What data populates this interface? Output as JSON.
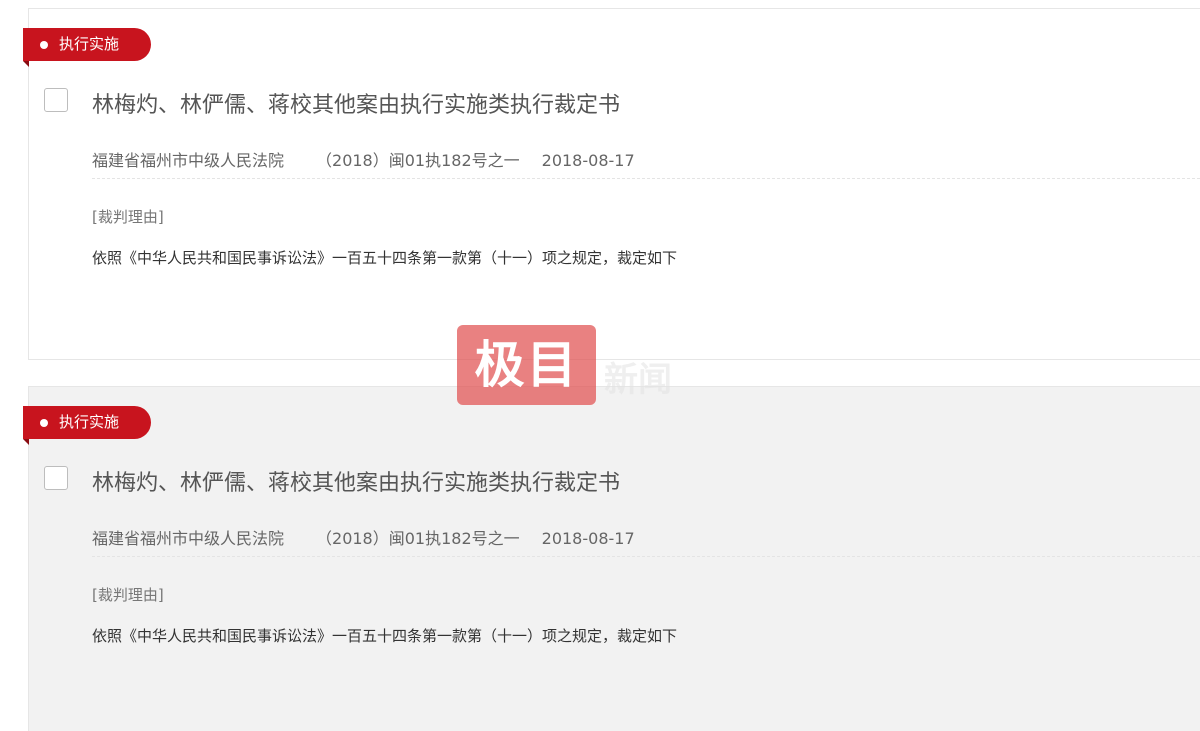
{
  "results": [
    {
      "tag": "执行实施",
      "title": "林梅灼、林俨儒、蒋校其他案由执行实施类执行裁定书",
      "court": "福建省福州市中级人民法院",
      "case_number": "（2018）闽01执182号之一",
      "date": "2018-08-17",
      "reason_label": "[裁判理由]",
      "reason_text": "依照《中华人民共和国民事诉讼法》一百五十四条第一款第（十一）项之规定，裁定如下"
    },
    {
      "tag": "执行实施",
      "title": "林梅灼、林俨儒、蒋校其他案由执行实施类执行裁定书",
      "court": "福建省福州市中级人民法院",
      "case_number": "（2018）闽01执182号之一",
      "date": "2018-08-17",
      "reason_label": "[裁判理由]",
      "reason_text": "依照《中华人民共和国民事诉讼法》一百五十四条第一款第（十一）项之规定，裁定如下"
    }
  ],
  "watermark": {
    "logo_text": "极目",
    "trailing_text": "新闻"
  },
  "colors": {
    "tag_red": "#c8141e",
    "watermark_red": "#e05050",
    "hover_background": "#f2f2f2"
  }
}
